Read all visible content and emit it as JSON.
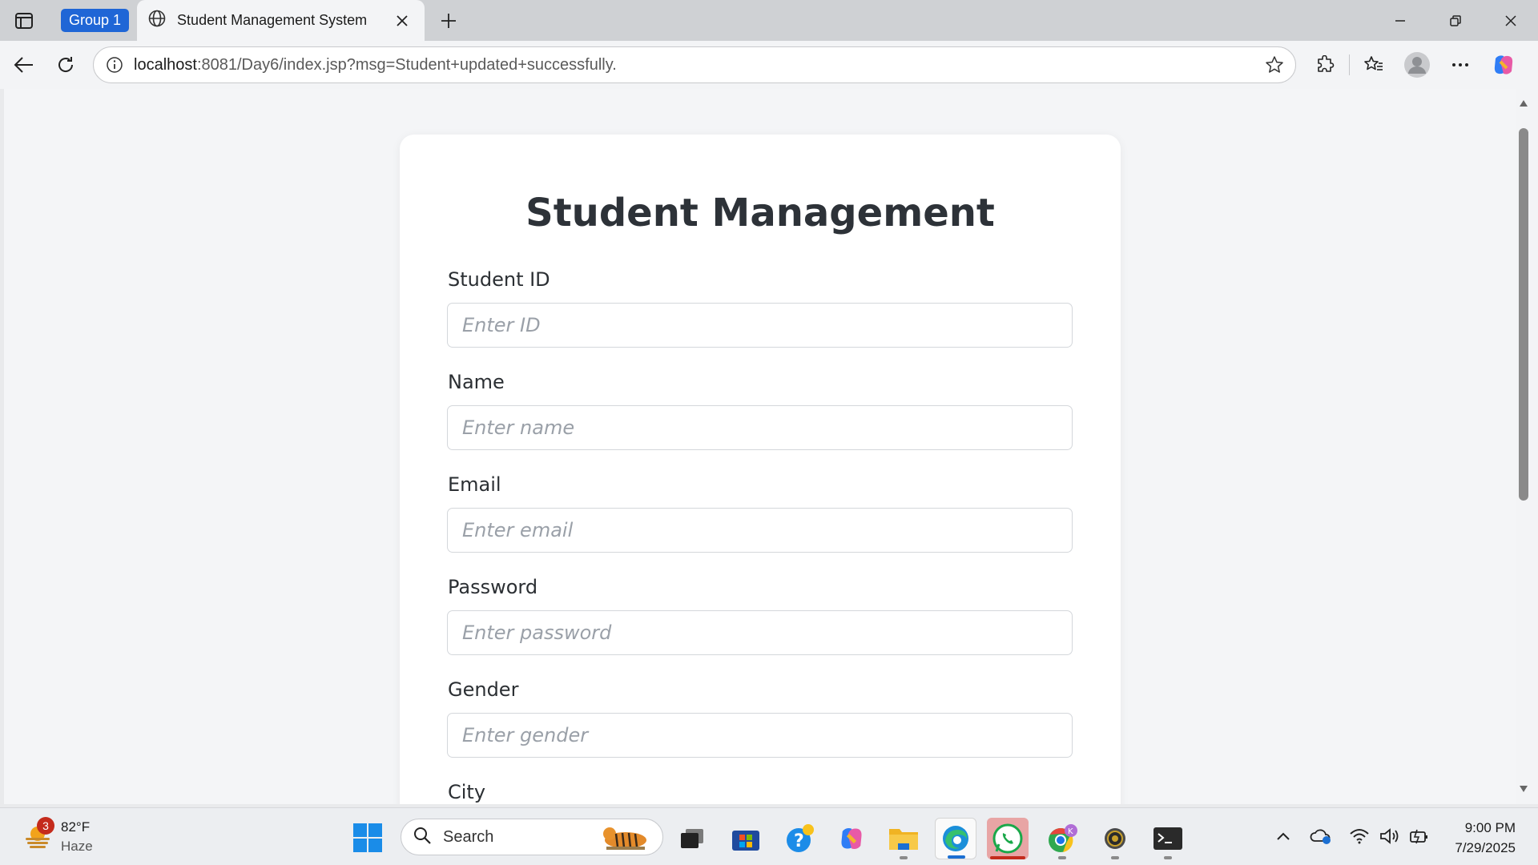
{
  "browser": {
    "tab_group_label": "Group 1",
    "tab_title": "Student Management System",
    "url_host": "localhost",
    "url_rest": ":8081/Day6/index.jsp?msg=Student+updated+successfully."
  },
  "page": {
    "heading": "Student Management",
    "fields": [
      {
        "label": "Student ID",
        "placeholder": "Enter ID"
      },
      {
        "label": "Name",
        "placeholder": "Enter name"
      },
      {
        "label": "Email",
        "placeholder": "Enter email"
      },
      {
        "label": "Password",
        "placeholder": "Enter password"
      },
      {
        "label": "Gender",
        "placeholder": "Enter gender"
      },
      {
        "label": "City",
        "placeholder": ""
      }
    ]
  },
  "taskbar": {
    "weather_temp": "82°F",
    "weather_cond": "Haze",
    "weather_badge": "3",
    "search_label": "Search",
    "time": "9:00 PM",
    "date": "7/29/2025",
    "chrome_badge": "K"
  },
  "colors": {
    "group_chip": "#1f66d6",
    "whatsapp_active": "#e8a5a5",
    "heading": "#2d3238"
  }
}
